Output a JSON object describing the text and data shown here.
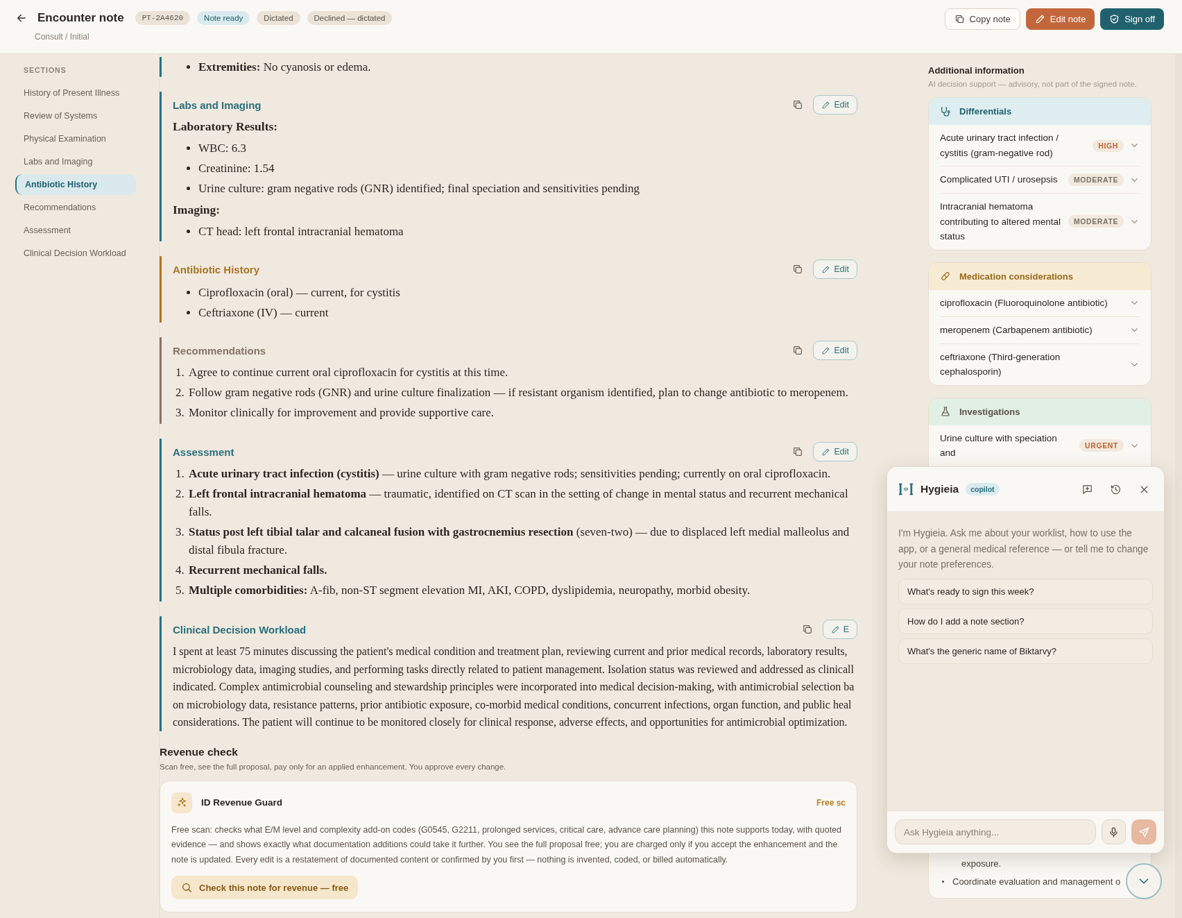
{
  "header": {
    "title": "Encounter note",
    "subtitle": "Consult / Initial",
    "chips": [
      {
        "text": "PT-2A4620",
        "kind": "id"
      },
      {
        "text": "Note ready",
        "kind": "status"
      },
      {
        "text": "Dictated",
        "kind": "tag"
      },
      {
        "text": "Declined — dictated",
        "kind": "tag"
      }
    ],
    "actions": [
      {
        "label": "Copy note",
        "kind": "outline"
      },
      {
        "label": "Edit note",
        "kind": "accent"
      },
      {
        "label": "Sign off",
        "kind": "primary"
      }
    ]
  },
  "sidebar": {
    "heading": "SECTIONS",
    "items": [
      {
        "label": "History of Present Illness",
        "selected": false
      },
      {
        "label": "Review of Systems",
        "selected": false
      },
      {
        "label": "Physical Examination",
        "selected": false
      },
      {
        "label": "Labs and Imaging",
        "selected": false
      },
      {
        "label": "Antibiotic History",
        "selected": true
      },
      {
        "label": "Recommendations",
        "selected": false
      },
      {
        "label": "Assessment",
        "selected": false
      },
      {
        "label": "Clinical Decision Workload",
        "selected": false
      }
    ]
  },
  "note": {
    "sections": [
      {
        "color": "#2a6f7d",
        "blocks": [
          {
            "kind": "bullets",
            "items": [
              "**Extremities:** No cyanosis or edema."
            ]
          }
        ]
      },
      {
        "title": "Labs and Imaging",
        "edit_label": "Edit",
        "color": "#2a6f7d",
        "blocks": [
          {
            "kind": "subheading",
            "text": "Laboratory Results:"
          },
          {
            "kind": "bullets",
            "items": [
              "WBC: 6.3",
              "Creatinine: 1.54",
              "Urine culture: gram negative rods (GNR) identified; final speciation and sensitivities pending"
            ]
          },
          {
            "kind": "subheading",
            "text": "Imaging:"
          },
          {
            "kind": "bullets",
            "items": [
              "CT head: left frontal intracranial hematoma"
            ]
          }
        ]
      },
      {
        "title": "Antibiotic History",
        "edit_label": "Edit",
        "color": "#a87628",
        "blocks": [
          {
            "kind": "bullets",
            "items": [
              "Ciprofloxacin (oral) — current, for cystitis",
              "Ceftriaxone (IV) — current"
            ]
          }
        ]
      },
      {
        "title": "Recommendations",
        "edit_label": "Edit",
        "color": "#857565",
        "blocks": [
          {
            "kind": "numbered",
            "items": [
              {
                "number": "1.",
                "text": "Agree to continue current oral ciprofloxacin for cystitis at this time."
              },
              {
                "number": "2.",
                "text": "Follow gram negative rods (GNR) and urine culture finalization — if resistant organism identified, plan to change antibiotic to meropenem."
              },
              {
                "number": "3.",
                "text": "Monitor clinically for improvement and provide supportive care."
              }
            ]
          }
        ]
      },
      {
        "title": "Assessment",
        "edit_label": "Edit",
        "color": "#2a6f7d",
        "blocks": [
          {
            "kind": "numbered",
            "items": [
              {
                "number": "1.",
                "text": "**Acute urinary tract infection (cystitis)** — urine culture with gram negative rods; sensitivities pending; currently on oral ciprofloxacin."
              },
              {
                "number": "2.",
                "text": "**Left frontal intracranial hematoma** — traumatic, identified on CT scan in the setting of change in mental status and recurrent mechanical falls."
              },
              {
                "number": "3.",
                "text": "**Status post left tibial talar and calcaneal fusion with gastrocnemius resection** (seven-two) — due to displaced left medial malleolus and distal fibula fracture."
              },
              {
                "number": "4.",
                "text": "**Recurrent mechanical falls.**"
              },
              {
                "number": "5.",
                "text": "**Multiple comorbidities:** A-fib, non-ST segment elevation MI, AKI, COPD, dyslipidemia, neuropathy, morbid obesity."
              }
            ]
          }
        ]
      },
      {
        "title": "Clinical Decision Workload",
        "edit_label": "E",
        "color": "#2a6f7d",
        "blocks": [
          {
            "kind": "lines",
            "items": [
              "I spent at least 75 minutes discussing the patient's medical condition and treatment plan, reviewing current and prior medical records, laboratory results,",
              "microbiology data, imaging studies, and performing tasks directly related to patient management. Isolation status was reviewed and addressed as clinicall",
              "indicated. Complex antimicrobial counseling and stewardship principles were incorporated into medical decision-making, with antimicrobial selection ba",
              "on microbiology data, resistance patterns, prior antibiotic exposure, co-morbid medical conditions, concurrent infections, organ function, and public heal",
              "considerations. The patient will continue to be monitored closely for clinical response, adverse effects, and opportunities for antimicrobial optimization."
            ]
          }
        ]
      }
    ]
  },
  "revenue_check": {
    "title": "Revenue check",
    "subtitle": "Scan free, see the full proposal, pay only for an applied enhancement. You approve every change.",
    "card": {
      "name": "ID Revenue Guard",
      "badge": "Free sc",
      "description": "Free scan: checks what E/M level and complexity add-on codes (G0545, G2211, prolonged services, critical care, advance care planning) this note supports today, with quoted evidence — and shows exactly what documentation additions could take it further. You see the full proposal free; you are charged only if you accept the enhancement and the note is updated. Every edit is a restatement of documented content or confirmed by you first — nothing is invented, coded, or billed automatically.",
      "button": "Check this note for revenue — free"
    }
  },
  "additional_information": {
    "title": "Additional information",
    "subtitle": "AI decision support — advisory, not part of the signed note.",
    "cards": [
      {
        "kind": "differentials",
        "title": "Differentials",
        "items": [
          {
            "text": "Acute urinary tract infection / cystitis (gram-negative rod)",
            "badge": "HIGH",
            "color": "#bf6433"
          },
          {
            "text": "Complicated UTI / urosepsis",
            "badge": "MODERATE",
            "color": "#7a7068"
          },
          {
            "text": "Intracranial hematoma contributing to altered mental status",
            "badge": "MODERATE",
            "color": "#7a7068"
          }
        ]
      },
      {
        "kind": "medications",
        "title": "Medication considerations",
        "items": [
          {
            "text": "ciprofloxacin (Fluoroquinolone antibiotic)"
          },
          {
            "text": "meropenem (Carbapenem antibiotic)"
          },
          {
            "text": "ceftriaxone (Third-generation cephalosporin)"
          }
        ]
      },
      {
        "kind": "investigations",
        "title": "Investigations",
        "items": [
          {
            "text": "Urine culture with speciation and",
            "badge": "URGENT",
            "color": "#bf6433"
          }
        ],
        "more": [
          {
            "text": "exposure.",
            "bullet": false
          },
          {
            "text": "Coordinate evaluation and management o",
            "bullet": true
          }
        ]
      }
    ]
  },
  "copilot": {
    "name": "Hygieia",
    "badge": "copilot",
    "intro": "I'm Hygieia. Ask me about your worklist, how to use the app, or a general medical reference — or tell me to change your note preferences.",
    "suggestions": [
      "What's ready to sign this week?",
      "How do I add a note section?",
      "What's the generic name of Biktarvy?"
    ],
    "placeholder": "Ask Hygieia anything..."
  }
}
